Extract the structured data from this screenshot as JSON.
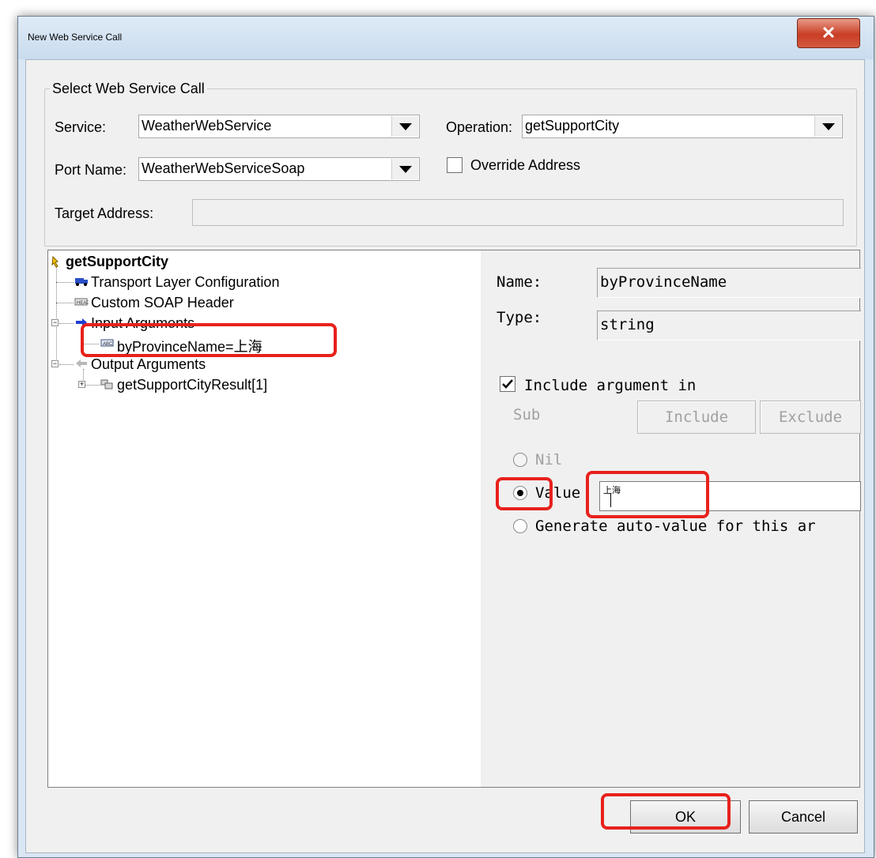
{
  "window": {
    "title": "New Web Service Call",
    "close_glyph": "✕"
  },
  "group": {
    "legend": "Select Web Service Call",
    "service_label": "Service:",
    "service_value": "WeatherWebService",
    "operation_label": "Operation:",
    "operation_value": "getSupportCity",
    "port_label": "Port Name:",
    "port_value": "WeatherWebServiceSoap",
    "override_label": "Override Address",
    "override_checked": false,
    "target_label": "Target Address:",
    "target_value": ""
  },
  "tree": {
    "root": "getSupportCity",
    "transport": "Transport Layer Configuration",
    "soap_header": "Custom SOAP Header",
    "input_args": "Input Arguments",
    "input_arg_item": "byProvinceName=上海",
    "output_args": "Output Arguments",
    "output_arg_item": "getSupportCityResult[1]",
    "expand_glyph": "−",
    "collapse_glyph": "+",
    "icons": [
      "operation-icon",
      "transport-icon",
      "header-icon",
      "input-arrow-icon",
      "string-arg-icon",
      "output-arrow-icon",
      "array-icon"
    ]
  },
  "details": {
    "name_label": "Name:",
    "name_value": "byProvinceName",
    "type_label": "Type:",
    "type_value": "string",
    "include_label": "Include argument in",
    "include_checked": true,
    "sub_label": "Sub",
    "include_button": "Include",
    "exclude_button": "Exclude",
    "nil_label": "Nil",
    "value_label": "Value",
    "value_text": "上海",
    "auto_label": "Generate auto-value for this ar",
    "selected_option": "Value"
  },
  "buttons": {
    "ok": "OK",
    "cancel": "Cancel"
  },
  "colors": {
    "highlight": "#e8211c",
    "title_bar": "#d9e6f3",
    "close_button": "#c83e25"
  }
}
